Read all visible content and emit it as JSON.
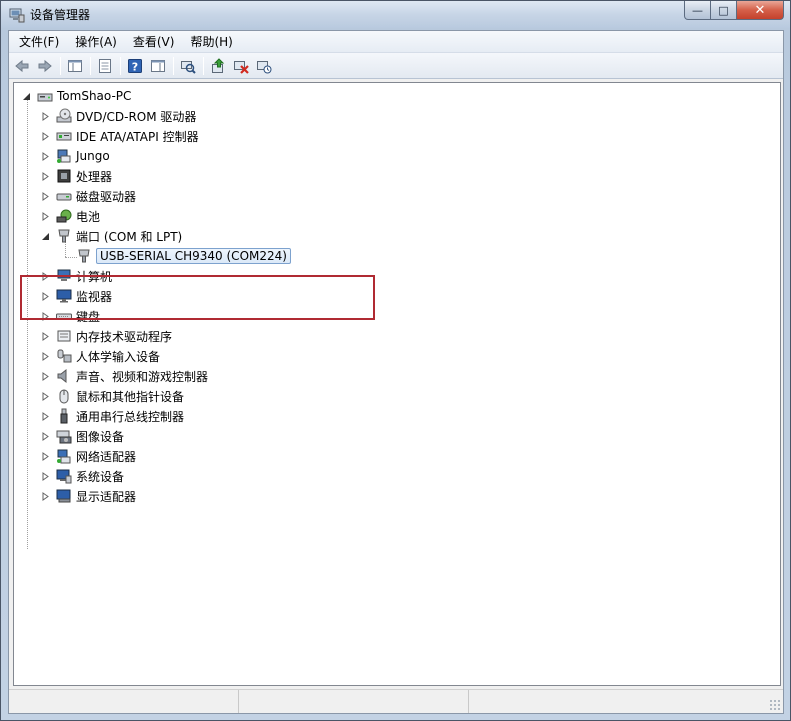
{
  "window": {
    "title": "设备管理器",
    "controls": {
      "minimize": "—",
      "maximize": "□",
      "close": "✕"
    },
    "icon": "device-manager-icon"
  },
  "menu": {
    "items": [
      {
        "label": "文件(F)",
        "name": "menu-file"
      },
      {
        "label": "操作(A)",
        "name": "menu-action"
      },
      {
        "label": "查看(V)",
        "name": "menu-view"
      },
      {
        "label": "帮助(H)",
        "name": "menu-help"
      }
    ]
  },
  "toolbar": {
    "buttons": [
      "back-arrow-icon",
      "forward-arrow-icon",
      "separator",
      "show-hide-console-tree-icon",
      "separator",
      "properties-icon",
      "separator",
      "help-icon",
      "show-action-pane-icon",
      "separator",
      "scan-hardware-changes-icon",
      "separator",
      "update-driver-icon",
      "disable-device-icon",
      "uninstall-device-icon"
    ]
  },
  "tree": {
    "root": {
      "label": "TomShao-PC",
      "icon": "computer-icon",
      "expanded": true
    },
    "items": [
      {
        "label": "DVD/CD-ROM 驱动器",
        "icon": "dvd-drive-icon",
        "expanded": false
      },
      {
        "label": "IDE ATA/ATAPI 控制器",
        "icon": "ide-controller-icon",
        "expanded": false
      },
      {
        "label": "Jungo",
        "icon": "jungo-device-icon",
        "expanded": false
      },
      {
        "label": "处理器",
        "icon": "processor-icon",
        "expanded": false
      },
      {
        "label": "磁盘驱动器",
        "icon": "disk-drive-icon",
        "expanded": false
      },
      {
        "label": "电池",
        "icon": "battery-icon",
        "expanded": false
      },
      {
        "label": "端口 (COM 和 LPT)",
        "icon": "port-icon",
        "expanded": true,
        "children": [
          {
            "label": "USB-SERIAL CH9340 (COM224)",
            "icon": "serial-port-icon",
            "selected": true
          }
        ]
      },
      {
        "label": "计算机",
        "icon": "computer-category-icon",
        "expanded": false
      },
      {
        "label": "监视器",
        "icon": "monitor-icon",
        "expanded": false
      },
      {
        "label": "键盘",
        "icon": "keyboard-icon",
        "expanded": false
      },
      {
        "label": "内存技术驱动程序",
        "icon": "memory-technology-icon",
        "expanded": false
      },
      {
        "label": "人体学输入设备",
        "icon": "hid-icon",
        "expanded": false
      },
      {
        "label": "声音、视频和游戏控制器",
        "icon": "sound-icon",
        "expanded": false
      },
      {
        "label": "鼠标和其他指针设备",
        "icon": "mouse-icon",
        "expanded": false
      },
      {
        "label": "通用串行总线控制器",
        "icon": "usb-controller-icon",
        "expanded": false
      },
      {
        "label": "图像设备",
        "icon": "imaging-device-icon",
        "expanded": false
      },
      {
        "label": "网络适配器",
        "icon": "network-adapter-icon",
        "expanded": false
      },
      {
        "label": "系统设备",
        "icon": "system-device-icon",
        "expanded": false
      },
      {
        "label": "显示适配器",
        "icon": "display-adapter-icon",
        "expanded": false
      }
    ]
  },
  "colors": {
    "highlight_box": "#b02a32",
    "selection_border": "#7da2ce"
  }
}
